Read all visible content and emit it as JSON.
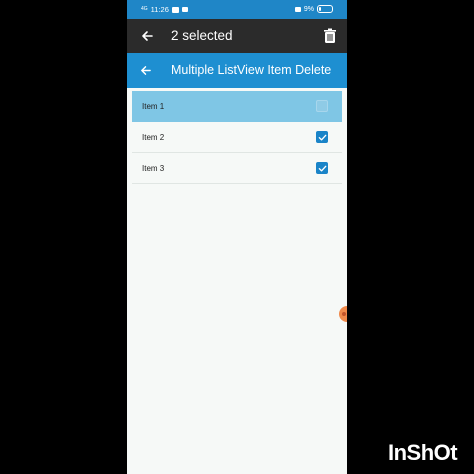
{
  "status_bar": {
    "signal_text": "4G",
    "time": "11:26",
    "battery_text": "9%"
  },
  "action_bar": {
    "title": "2 selected",
    "back_icon": "arrow-left-icon",
    "delete_icon": "trash-icon"
  },
  "toolbar": {
    "title": "Multiple ListView Item Delete",
    "back_icon": "arrow-left-icon"
  },
  "list": {
    "items": [
      {
        "label": "Item 1",
        "checked": true,
        "highlighted": true
      },
      {
        "label": "Item 2",
        "checked": true,
        "highlighted": false
      },
      {
        "label": "Item 3",
        "checked": true,
        "highlighted": false
      }
    ]
  },
  "watermark": {
    "text": "InShOt"
  },
  "colors": {
    "status_bar": "#1f86c7",
    "action_bar": "#2b2b2b",
    "toolbar": "#1e8fd1",
    "selected_row": "#7fc6e5",
    "checkbox": "#1a84c8",
    "background": "#f6f9f7"
  }
}
